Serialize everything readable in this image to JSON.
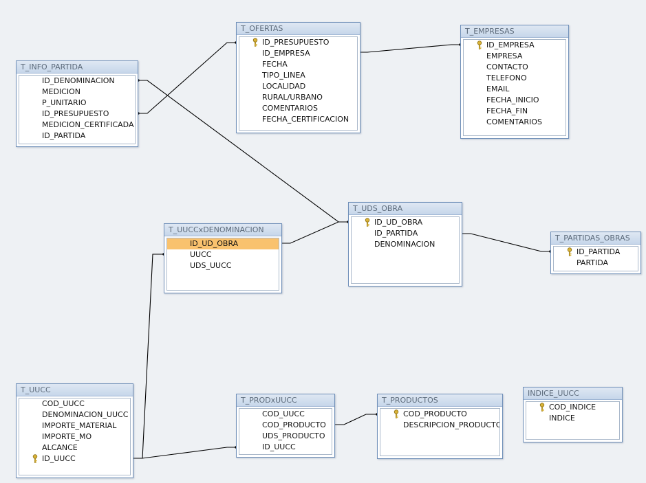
{
  "tables": {
    "info_partida": {
      "title": "T_INFO_PARTIDA",
      "fields": [
        "ID_DENOMINACION",
        "MEDICION",
        "P_UNITARIO",
        "ID_PRESUPUESTO",
        "MEDICION_CERTIFICADA",
        "ID_PARTIDA"
      ]
    },
    "ofertas": {
      "title": "T_OFERTAS",
      "fields": [
        "ID_PRESUPUESTO",
        "ID_EMPRESA",
        "FECHA",
        "TIPO_LINEA",
        "LOCALIDAD",
        "RURAL/URBANO",
        "COMENTARIOS",
        "FECHA_CERTIFICACION"
      ]
    },
    "empresas": {
      "title": "T_EMPRESAS",
      "fields": [
        "ID_EMPRESA",
        "EMPRESA",
        "CONTACTO",
        "TELEFONO",
        "EMAIL",
        "FECHA_INICIO",
        "FECHA_FIN",
        "COMENTARIOS"
      ]
    },
    "uds_obra": {
      "title": "T_UDS_OBRA",
      "fields": [
        "ID_UD_OBRA",
        "ID_PARTIDA",
        "DENOMINACION"
      ]
    },
    "uuccxdenominacion": {
      "title": "T_UUCCxDENOMINACION",
      "fields": [
        "ID_UD_OBRA",
        "UUCC",
        "UDS_UUCC"
      ]
    },
    "partidas_obras": {
      "title": "T_PARTIDAS_OBRAS",
      "fields": [
        "ID_PARTIDA",
        "PARTIDA"
      ]
    },
    "uucc": {
      "title": "T_UUCC",
      "fields": [
        "COD_UUCC",
        "DENOMINACION_UUCC",
        "IMPORTE_MATERIAL",
        "IMPORTE_MO",
        "ALCANCE",
        "ID_UUCC"
      ]
    },
    "prodxuucc": {
      "title": "T_PRODxUUCC",
      "fields": [
        "COD_UUCC",
        "COD_PRODUCTO",
        "UDS_PRODUCTO",
        "ID_UUCC"
      ]
    },
    "productos": {
      "title": "T_PRODUCTOS",
      "fields": [
        "COD_PRODUCTO",
        "DESCRIPCION_PRODUCTO"
      ]
    },
    "indice_uucc": {
      "title": "INDICE_UUCC",
      "fields": [
        "COD_INDICE",
        "INDICE"
      ]
    }
  },
  "colors": {
    "background": "#eef1f4",
    "border": "#6f8fb8",
    "title_bar": "#c6d6ea",
    "selected_field": "#f9c26e",
    "key_icon": "#d9b338",
    "relationship_line": "#000000"
  },
  "icons": {
    "primary_key": "key-icon"
  }
}
